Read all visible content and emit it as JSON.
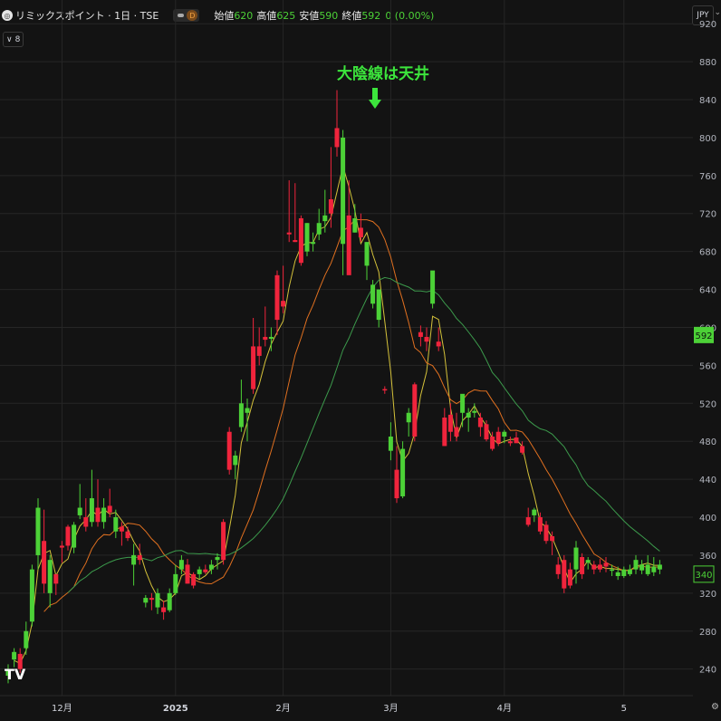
{
  "header": {
    "symbol_icon": "company-logo-icon",
    "title": "リミックスポイント · 1日 · TSE",
    "visibility_icon": "eye-icon",
    "badge": "D",
    "open_label": "始値",
    "open_value": "620",
    "high_label": "高値",
    "high_value": "625",
    "low_label": "安値",
    "low_value": "590",
    "close_label": "終値",
    "close_value": "592",
    "change": "0 (0.00%)"
  },
  "indicator_toggle": {
    "chevron_icon": "chevron-down-icon",
    "count": "8"
  },
  "currency": "JPY",
  "annotation": "大陰線は天井",
  "price_labels": {
    "last": "592",
    "ma": "340"
  },
  "colors": {
    "up": "#4cd137",
    "down": "#f0243c",
    "ma_short": "#d4c13a",
    "ma_mid": "#e07020",
    "ma_long": "#3c9a4c",
    "background": "#131313",
    "grid": "#262626",
    "annotation": "#3ce53c"
  },
  "chart_data": {
    "type": "candlestick",
    "yaxis": {
      "ticks": [
        240,
        280,
        320,
        360,
        400,
        440,
        480,
        520,
        560,
        600,
        640,
        680,
        720,
        760,
        800,
        840,
        880,
        920
      ],
      "range": [
        212,
        945
      ]
    },
    "xaxis": {
      "ticks": [
        {
          "label": "12月",
          "index": 9
        },
        {
          "label": "2025",
          "index": 28
        },
        {
          "label": "2月",
          "index": 46
        },
        {
          "label": "3月",
          "index": 64
        },
        {
          "label": "4月",
          "index": 83
        },
        {
          "label": "5",
          "index": 103
        }
      ]
    },
    "grid": true,
    "candles": [
      {
        "o": 233,
        "h": 245,
        "l": 225,
        "c": 240
      },
      {
        "o": 250,
        "h": 262,
        "l": 242,
        "c": 258
      },
      {
        "o": 256,
        "h": 262,
        "l": 236,
        "c": 240
      },
      {
        "o": 262,
        "h": 290,
        "l": 255,
        "c": 280
      },
      {
        "o": 290,
        "h": 350,
        "l": 285,
        "c": 345
      },
      {
        "o": 360,
        "h": 420,
        "l": 345,
        "c": 410
      },
      {
        "o": 375,
        "h": 408,
        "l": 320,
        "c": 330
      },
      {
        "o": 320,
        "h": 360,
        "l": 305,
        "c": 355
      },
      {
        "o": 340,
        "h": 340,
        "l": 318,
        "c": 330
      },
      {
        "o": 370,
        "h": 375,
        "l": 352,
        "c": 368
      },
      {
        "o": 390,
        "h": 392,
        "l": 365,
        "c": 370
      },
      {
        "o": 368,
        "h": 395,
        "l": 362,
        "c": 392
      },
      {
        "o": 402,
        "h": 435,
        "l": 398,
        "c": 410
      },
      {
        "o": 400,
        "h": 420,
        "l": 385,
        "c": 390
      },
      {
        "o": 395,
        "h": 450,
        "l": 390,
        "c": 420
      },
      {
        "o": 410,
        "h": 440,
        "l": 390,
        "c": 395
      },
      {
        "o": 395,
        "h": 420,
        "l": 388,
        "c": 410
      },
      {
        "o": 412,
        "h": 430,
        "l": 400,
        "c": 405
      },
      {
        "o": 385,
        "h": 408,
        "l": 378,
        "c": 400
      },
      {
        "o": 390,
        "h": 395,
        "l": 370,
        "c": 385
      },
      {
        "o": 385,
        "h": 390,
        "l": 375,
        "c": 378
      },
      {
        "o": 350,
        "h": 372,
        "l": 328,
        "c": 360
      },
      {
        "o": 360,
        "h": 372,
        "l": 350,
        "c": 355
      },
      {
        "o": 310,
        "h": 318,
        "l": 305,
        "c": 315
      },
      {
        "o": 315,
        "h": 320,
        "l": 302,
        "c": 313
      },
      {
        "o": 305,
        "h": 325,
        "l": 298,
        "c": 320
      },
      {
        "o": 305,
        "h": 312,
        "l": 292,
        "c": 300
      },
      {
        "o": 302,
        "h": 325,
        "l": 300,
        "c": 320
      },
      {
        "o": 320,
        "h": 350,
        "l": 318,
        "c": 340
      },
      {
        "o": 345,
        "h": 360,
        "l": 340,
        "c": 355
      },
      {
        "o": 350,
        "h": 356,
        "l": 330,
        "c": 330
      },
      {
        "o": 340,
        "h": 342,
        "l": 325,
        "c": 328
      },
      {
        "o": 340,
        "h": 348,
        "l": 335,
        "c": 345
      },
      {
        "o": 345,
        "h": 350,
        "l": 340,
        "c": 342
      },
      {
        "o": 345,
        "h": 355,
        "l": 340,
        "c": 350
      },
      {
        "o": 355,
        "h": 362,
        "l": 345,
        "c": 358
      },
      {
        "o": 395,
        "h": 398,
        "l": 350,
        "c": 355
      },
      {
        "o": 490,
        "h": 495,
        "l": 445,
        "c": 450
      },
      {
        "o": 455,
        "h": 470,
        "l": 440,
        "c": 465
      },
      {
        "o": 495,
        "h": 545,
        "l": 490,
        "c": 520
      },
      {
        "o": 510,
        "h": 525,
        "l": 480,
        "c": 515
      },
      {
        "o": 580,
        "h": 610,
        "l": 530,
        "c": 535
      },
      {
        "o": 580,
        "h": 600,
        "l": 560,
        "c": 570
      },
      {
        "o": 590,
        "h": 622,
        "l": 580,
        "c": 587
      },
      {
        "o": 588,
        "h": 600,
        "l": 575,
        "c": 590
      },
      {
        "o": 655,
        "h": 660,
        "l": 592,
        "c": 608
      },
      {
        "o": 628,
        "h": 665,
        "l": 615,
        "c": 622
      },
      {
        "o": 700,
        "h": 755,
        "l": 690,
        "c": 698
      },
      {
        "o": 692,
        "h": 752,
        "l": 690,
        "c": 690
      },
      {
        "o": 715,
        "h": 718,
        "l": 665,
        "c": 668
      },
      {
        "o": 680,
        "h": 710,
        "l": 675,
        "c": 710
      },
      {
        "o": 688,
        "h": 700,
        "l": 680,
        "c": 690
      },
      {
        "o": 698,
        "h": 725,
        "l": 692,
        "c": 710
      },
      {
        "o": 712,
        "h": 745,
        "l": 700,
        "c": 718
      },
      {
        "o": 735,
        "h": 790,
        "l": 705,
        "c": 720
      },
      {
        "o": 810,
        "h": 850,
        "l": 780,
        "c": 790
      },
      {
        "o": 688,
        "h": 808,
        "l": 655,
        "c": 800
      },
      {
        "o": 718,
        "h": 755,
        "l": 660,
        "c": 655
      },
      {
        "o": 700,
        "h": 730,
        "l": 700,
        "c": 715
      },
      {
        "o": 705,
        "h": 720,
        "l": 690,
        "c": 695
      },
      {
        "o": 665,
        "h": 690,
        "l": 650,
        "c": 690
      },
      {
        "o": 625,
        "h": 650,
        "l": 620,
        "c": 645
      },
      {
        "o": 608,
        "h": 640,
        "l": 600,
        "c": 640
      },
      {
        "o": 535,
        "h": 538,
        "l": 530,
        "c": 534
      },
      {
        "o": 470,
        "h": 500,
        "l": 460,
        "c": 485
      },
      {
        "o": 450,
        "h": 475,
        "l": 415,
        "c": 420
      },
      {
        "o": 422,
        "h": 480,
        "l": 420,
        "c": 472
      },
      {
        "o": 500,
        "h": 515,
        "l": 485,
        "c": 510
      },
      {
        "o": 540,
        "h": 542,
        "l": 480,
        "c": 485
      },
      {
        "o": 595,
        "h": 602,
        "l": 580,
        "c": 590
      },
      {
        "o": 590,
        "h": 600,
        "l": 575,
        "c": 585
      },
      {
        "o": 625,
        "h": 650,
        "l": 620,
        "c": 660
      },
      {
        "o": 585,
        "h": 600,
        "l": 575,
        "c": 580
      },
      {
        "o": 505,
        "h": 515,
        "l": 475,
        "c": 475
      },
      {
        "o": 508,
        "h": 520,
        "l": 480,
        "c": 490
      },
      {
        "o": 495,
        "h": 510,
        "l": 480,
        "c": 485
      },
      {
        "o": 510,
        "h": 520,
        "l": 495,
        "c": 530
      },
      {
        "o": 505,
        "h": 515,
        "l": 490,
        "c": 510
      },
      {
        "o": 510,
        "h": 520,
        "l": 505,
        "c": 512
      },
      {
        "o": 505,
        "h": 510,
        "l": 485,
        "c": 495
      },
      {
        "o": 498,
        "h": 502,
        "l": 480,
        "c": 482
      },
      {
        "o": 485,
        "h": 490,
        "l": 470,
        "c": 472
      },
      {
        "o": 490,
        "h": 495,
        "l": 475,
        "c": 478
      },
      {
        "o": 485,
        "h": 492,
        "l": 478,
        "c": 490
      },
      {
        "o": 480,
        "h": 485,
        "l": 475,
        "c": 478
      },
      {
        "o": 484,
        "h": 490,
        "l": 480,
        "c": 478
      },
      {
        "o": 475,
        "h": 480,
        "l": 466,
        "c": 468
      },
      {
        "o": 400,
        "h": 410,
        "l": 390,
        "c": 392
      },
      {
        "o": 402,
        "h": 410,
        "l": 395,
        "c": 408
      },
      {
        "o": 400,
        "h": 405,
        "l": 382,
        "c": 385
      },
      {
        "o": 392,
        "h": 396,
        "l": 372,
        "c": 375
      },
      {
        "o": 380,
        "h": 385,
        "l": 360,
        "c": 375
      },
      {
        "o": 350,
        "h": 358,
        "l": 335,
        "c": 340
      },
      {
        "o": 355,
        "h": 360,
        "l": 320,
        "c": 325
      },
      {
        "o": 345,
        "h": 352,
        "l": 325,
        "c": 328
      },
      {
        "o": 345,
        "h": 375,
        "l": 330,
        "c": 368
      },
      {
        "o": 358,
        "h": 362,
        "l": 335,
        "c": 340
      },
      {
        "o": 352,
        "h": 358,
        "l": 345,
        "c": 355
      },
      {
        "o": 350,
        "h": 354,
        "l": 340,
        "c": 345
      },
      {
        "o": 350,
        "h": 356,
        "l": 342,
        "c": 345
      },
      {
        "o": 352,
        "h": 358,
        "l": 342,
        "c": 348
      },
      {
        "o": 345,
        "h": 350,
        "l": 338,
        "c": 345
      },
      {
        "o": 338,
        "h": 348,
        "l": 334,
        "c": 342
      },
      {
        "o": 338,
        "h": 348,
        "l": 336,
        "c": 345
      },
      {
        "o": 340,
        "h": 350,
        "l": 338,
        "c": 345
      },
      {
        "o": 345,
        "h": 360,
        "l": 340,
        "c": 355
      },
      {
        "o": 344,
        "h": 355,
        "l": 340,
        "c": 350
      },
      {
        "o": 340,
        "h": 360,
        "l": 338,
        "c": 350
      },
      {
        "o": 342,
        "h": 358,
        "l": 338,
        "c": 348
      },
      {
        "o": 345,
        "h": 355,
        "l": 340,
        "c": 350
      }
    ]
  }
}
